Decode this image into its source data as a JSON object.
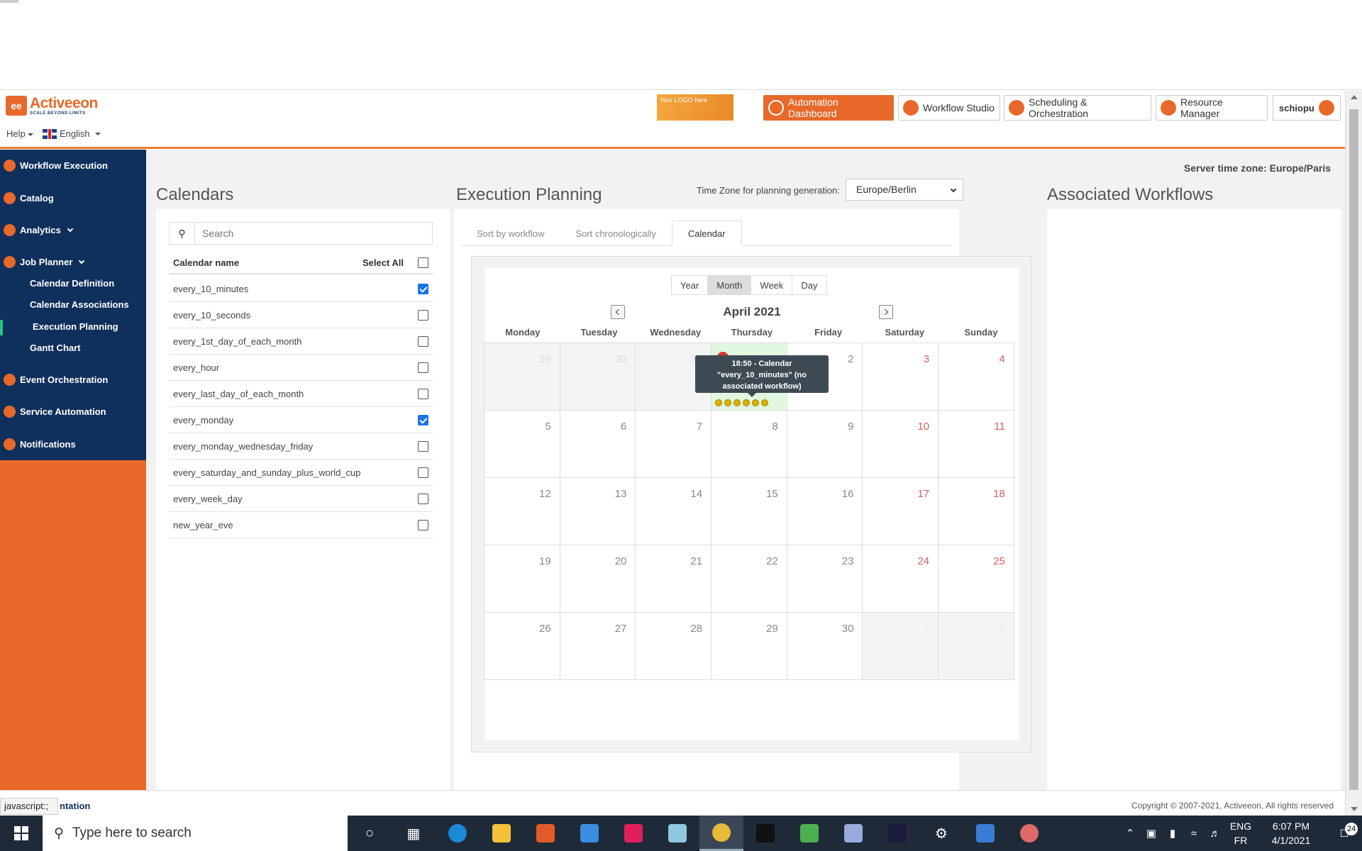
{
  "header": {
    "logo_name": "Activeeon",
    "logo_tag": "SCALE BEYOND LIMITS",
    "help_label": "Help",
    "language": "English",
    "your_logo": "Your LOGO here",
    "nav": [
      {
        "label": "Automation Dashboard"
      },
      {
        "label": "Workflow Studio"
      },
      {
        "label": "Scheduling & Orchestration"
      },
      {
        "label": "Resource Manager"
      }
    ],
    "user": "schiopu"
  },
  "sidebar": {
    "items": [
      {
        "label": "Workflow Execution"
      },
      {
        "label": "Catalog"
      },
      {
        "label": "Analytics"
      },
      {
        "label": "Job Planner"
      },
      {
        "label": "Event Orchestration"
      },
      {
        "label": "Service Automation"
      },
      {
        "label": "Notifications"
      }
    ],
    "job_planner_sub": [
      {
        "label": "Calendar Definition"
      },
      {
        "label": "Calendar Associations"
      },
      {
        "label": "Execution Planning"
      },
      {
        "label": "Gantt Chart"
      }
    ]
  },
  "main": {
    "server_tz": "Server time zone: Europe/Paris",
    "calendars": {
      "title": "Calendars",
      "search_placeholder": "Search",
      "col_name": "Calendar name",
      "select_all": "Select All",
      "rows": [
        {
          "name": "every_10_minutes",
          "checked": true
        },
        {
          "name": "every_10_seconds",
          "checked": false
        },
        {
          "name": "every_1st_day_of_each_month",
          "checked": false
        },
        {
          "name": "every_hour",
          "checked": false
        },
        {
          "name": "every_last_day_of_each_month",
          "checked": false
        },
        {
          "name": "every_monday",
          "checked": true
        },
        {
          "name": "every_monday_wednesday_friday",
          "checked": false
        },
        {
          "name": "every_saturday_and_sunday_plus_world_cup",
          "checked": false
        },
        {
          "name": "every_week_day",
          "checked": false
        },
        {
          "name": "new_year_eve",
          "checked": false
        }
      ]
    },
    "planning": {
      "title": "Execution Planning",
      "tz_label": "Time Zone for planning generation:",
      "tz_value": "Europe/Berlin",
      "tabs": [
        "Sort by workflow",
        "Sort chronologically",
        "Calendar"
      ],
      "views": [
        "Year",
        "Month",
        "Week",
        "Day"
      ],
      "month_title": "April 2021",
      "weekdays": [
        "Monday",
        "Tuesday",
        "Wednesday",
        "Thursday",
        "Friday",
        "Saturday",
        "Sunday"
      ],
      "weeks": [
        [
          "29",
          "30",
          "31",
          "1",
          "2",
          "3",
          "4"
        ],
        [
          "5",
          "6",
          "7",
          "8",
          "9",
          "10",
          "11"
        ],
        [
          "12",
          "13",
          "14",
          "15",
          "16",
          "17",
          "18"
        ],
        [
          "19",
          "20",
          "21",
          "22",
          "23",
          "24",
          "25"
        ],
        [
          "26",
          "27",
          "28",
          "29",
          "30",
          "1",
          "2"
        ]
      ],
      "event_dots": 6,
      "tooltip": "18:50 - Calendar \"every_10_minutes\" (no associated workflow)"
    },
    "associated": {
      "title": "Associated Workflows"
    }
  },
  "footer": {
    "status_tip": "javascript:;",
    "link_tail": "ntation",
    "copyright": "Copyright © 2007-2021, Activeeon, All rights reserved"
  },
  "taskbar": {
    "search_placeholder": "Type here to search",
    "lang1": "ENG",
    "lang2": "FR",
    "time": "6:07 PM",
    "date": "4/1/2021",
    "notif_count": "24"
  }
}
